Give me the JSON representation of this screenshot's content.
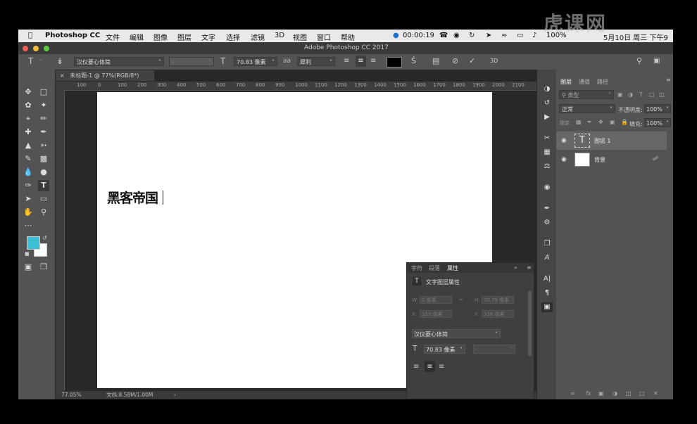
{
  "menubar": {
    "apple": "",
    "app_name": "Photoshop CC",
    "items": [
      "文件",
      "编辑",
      "图像",
      "图层",
      "文字",
      "选择",
      "滤镜",
      "3D",
      "视图",
      "窗口",
      "帮助"
    ],
    "timer": "00:00:19",
    "battery": "100%",
    "date": "5月10日 周三 下午9"
  },
  "watermark": "虎课网",
  "window": {
    "title": "Adobe Photoshop CC 2017"
  },
  "options": {
    "font_family": "汉仪菱心体简",
    "font_style": "-",
    "font_size": "70.83 像素",
    "aa_icon": "aa",
    "antialias": "犀利",
    "btn_3d": "3D"
  },
  "document": {
    "tab_title": "未标题-1 @ 77%(RGB/8*)",
    "ruler_labels": [
      "100",
      "0",
      "100",
      "200",
      "300",
      "400",
      "500",
      "600",
      "700",
      "800",
      "900",
      "1000",
      "1100",
      "1200",
      "1300",
      "1400",
      "1500",
      "1600",
      "1700",
      "1800",
      "1900",
      "2000",
      "2100"
    ],
    "canvas_text": "黑客帝国",
    "zoom": "77.05%",
    "doc_size": "文档:8.58M/1.00M"
  },
  "properties": {
    "tabs": [
      "字符",
      "段落",
      "属性"
    ],
    "header": "文字图层属性",
    "w_label": "W:",
    "w_value": "0 像素",
    "h_label": "H:",
    "h_value": "70.79 像素",
    "x_label": "X:",
    "x_value": "159 像素",
    "y_label": "Y:",
    "y_value": "536 像素",
    "font_family": "汉仪菱心体简",
    "font_size": "70.83 像素",
    "font_style": "-"
  },
  "layers": {
    "tabs": [
      "图层",
      "通道",
      "路径"
    ],
    "filter_label": "类型",
    "blend_mode": "正常",
    "opacity_label": "不透明度:",
    "opacity_value": "100%",
    "lock_label": "锁定:",
    "fill_label": "填充:",
    "fill_value": "100%",
    "rows": [
      {
        "name": "图层 1",
        "thumb": "T"
      },
      {
        "name": "背景"
      }
    ]
  },
  "colors": {
    "foreground": "#3bbfd6",
    "background": "#ffffff"
  }
}
